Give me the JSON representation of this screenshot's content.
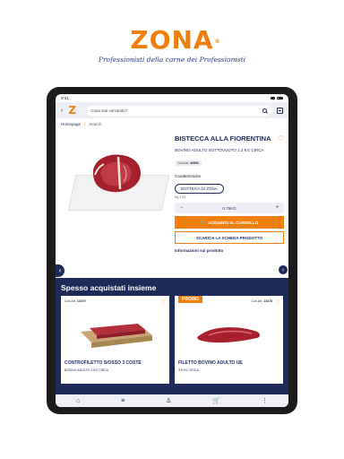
{
  "brand": {
    "logo_text": "ZONA",
    "registered": "®",
    "tagline": "Professionisti della carne dei Professionisti",
    "accent_color": "#f07f0c",
    "navy_color": "#1e2a5a"
  },
  "status_bar": {
    "time": "9:41"
  },
  "top_bar": {
    "back_icon": "chevron-left-icon",
    "logo_letter": "Z",
    "search_placeholder": "Cosa stai cercando?",
    "search_icon": "search-icon",
    "scan_icon": "barcode-scan-icon"
  },
  "breadcrumb": {
    "home": "Homepage",
    "separator": "/",
    "current": "Search"
  },
  "product": {
    "title": "BISTECCA ALLA FIORENTINA",
    "subtitle": "BOVINO ADULTO SOTTOVUOTO 1.2 KG CIRCA",
    "code_label": "Cod.Art.",
    "code_value": "40856",
    "characteristics_label": "Caratteristiche",
    "chip_label": "BOTTEGA DI ZONA",
    "chip_sub": "Kg 1.05",
    "qty_minus": "−",
    "qty_value": "0.75KG",
    "qty_plus": "+",
    "add_to_cart": "AGGIUNGI AL CARRELLO",
    "download_sheet": "SCARICA LA SCHEDA PRODOTTO",
    "info_link": "Informazioni sul prodotto"
  },
  "often_bought": {
    "title": "Spesso acquistati insieme",
    "cards": [
      {
        "code_label": "Cod.Art.",
        "code_value": "13479",
        "promo": "",
        "title": "CONTROFILETTO S/OSSO 3 COSTE",
        "subtitle": "BOVINO ADULTO 4 KG CIRCA"
      },
      {
        "code_label": "Cod.Art.",
        "code_value": "13478",
        "promo": "PROMO",
        "title": "FILETTO BOVINO ADULTO UE",
        "subtitle": "3.5 KG CIRCA"
      }
    ]
  },
  "bottom_nav": [
    {
      "icon": "home-icon",
      "glyph": "⌂"
    },
    {
      "icon": "menu-icon",
      "glyph": "≡"
    },
    {
      "icon": "user-icon",
      "glyph": "♙"
    },
    {
      "icon": "cart-icon",
      "glyph": "🛒"
    },
    {
      "icon": "more-icon",
      "glyph": "⋮"
    }
  ]
}
